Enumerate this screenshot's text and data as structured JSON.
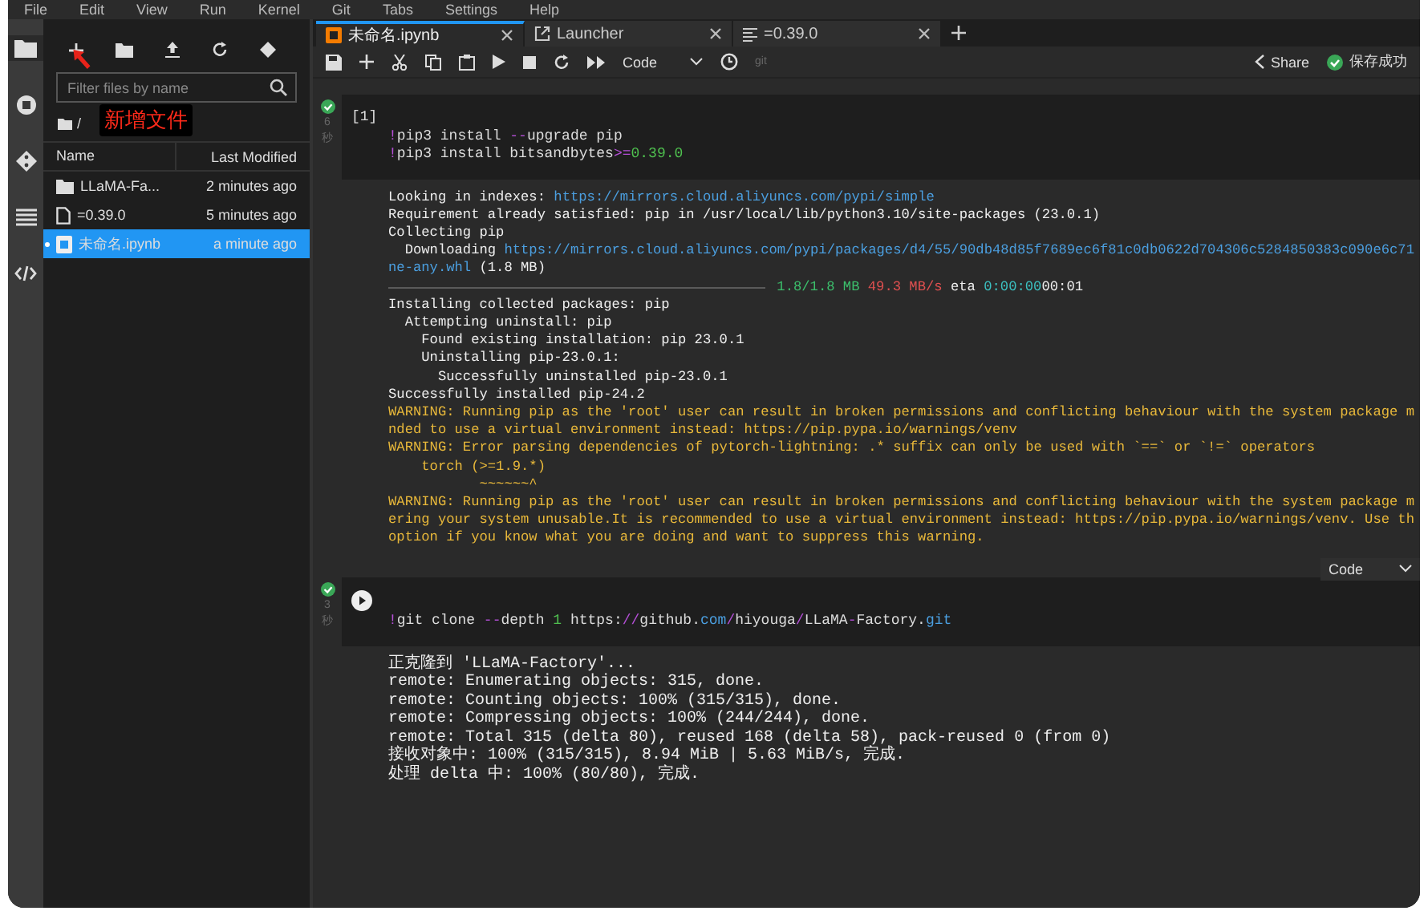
{
  "menu": [
    "File",
    "Edit",
    "View",
    "Run",
    "Kernel",
    "Git",
    "Tabs",
    "Settings",
    "Help"
  ],
  "activity_bar": [
    {
      "kind": "folder",
      "selected": true
    },
    {
      "kind": "running",
      "selected": false
    },
    {
      "kind": "git",
      "selected": false
    },
    {
      "kind": "toc",
      "selected": false
    },
    {
      "kind": "code",
      "selected": false
    }
  ],
  "file_browser": {
    "search": {
      "placeholder": "Filter files by name"
    },
    "path": "/",
    "columns": [
      "Name",
      "Last Modified"
    ],
    "rows": [
      {
        "kind": "folder",
        "name": "LLaMA-Fa...",
        "modified": "2 minutes ago",
        "selected": false,
        "running": false
      },
      {
        "kind": "file",
        "name": "=0.39.0",
        "modified": "5 minutes ago",
        "selected": false,
        "running": false
      },
      {
        "kind": "notebook",
        "name": "未命名.ipynb",
        "modified": "a minute ago",
        "selected": true,
        "running": true
      }
    ]
  },
  "annotation": {
    "label": "新增文件"
  },
  "tabs": [
    {
      "kind": "notebook",
      "label": "未命名.ipynb",
      "selected": true
    },
    {
      "kind": "launcher",
      "label": "Launcher",
      "selected": false
    },
    {
      "kind": "text",
      "label": "=0.39.0",
      "selected": false
    }
  ],
  "toolbar": {
    "cell_type": "Code",
    "git": "git",
    "share": "Share",
    "save_status": "保存成功"
  },
  "cells": [
    {
      "prompt": "[1]",
      "time": "6",
      "unit": "秒",
      "toolbar": false,
      "input": [
        [
          {
            "kind": "op",
            "text": "!"
          },
          {
            "kind": "plain",
            "text": "pip3 install "
          },
          {
            "kind": "op",
            "text": "--"
          },
          {
            "kind": "plain",
            "text": "upgrade pip"
          }
        ],
        [
          {
            "kind": "op",
            "text": "!"
          },
          {
            "kind": "plain",
            "text": "pip3 install bitsandbytes"
          },
          {
            "kind": "op",
            "text": ">="
          },
          {
            "kind": "num",
            "text": "0.39.0"
          }
        ]
      ],
      "output": [
        [
          {
            "kind": "plain",
            "text": "Looking in indexes: "
          },
          {
            "kind": "link",
            "text": "https://mirrors.cloud.aliyuncs.com/pypi/simple"
          }
        ],
        [
          {
            "kind": "plain",
            "text": "Requirement already satisfied: pip in /usr/local/lib/python3.10/site-packages (23.0.1)"
          }
        ],
        [
          {
            "kind": "plain",
            "text": "Collecting pip"
          }
        ],
        [
          {
            "kind": "plain",
            "text": "  Downloading "
          },
          {
            "kind": "link",
            "text": "https://mirrors.cloud.aliyuncs.com/pypi/packages/d4/55/90db48d85f7689ec6f81c0db0622d704306c5284850383c090e6c71"
          }
        ],
        [
          {
            "kind": "link",
            "text": "ne-any.whl"
          },
          {
            "kind": "plain",
            "text": " (1.8 MB)"
          }
        ],
        [
          {
            "kind": "bar",
            "level": 1
          },
          {
            "kind": "ok",
            "text": " 1.8/1.8 MB"
          },
          {
            "kind": "err",
            "text": " 49.3 MB/s"
          },
          {
            "kind": "plain",
            "text": " eta "
          },
          {
            "kind": "cyan",
            "text": "0:00:00"
          },
          {
            "kind": "plain",
            "text": "00:01"
          }
        ],
        [
          {
            "kind": "plain",
            "text": "Installing collected packages: pip"
          }
        ],
        [
          {
            "kind": "plain",
            "text": "  Attempting uninstall: pip"
          }
        ],
        [
          {
            "kind": "plain",
            "text": "    Found existing installation: pip 23.0.1"
          }
        ],
        [
          {
            "kind": "plain",
            "text": "    Uninstalling pip-23.0.1:"
          }
        ],
        [
          {
            "kind": "plain",
            "text": "      Successfully uninstalled pip-23.0.1"
          }
        ],
        [
          {
            "kind": "plain",
            "text": "Successfully installed pip-24.2"
          }
        ],
        [
          {
            "kind": "warn",
            "text": "WARNING: Running pip as the 'root' user can result in broken permissions and conflicting behaviour with the system package m"
          }
        ],
        [
          {
            "kind": "warn",
            "text": "nded to use a virtual environment instead: https://pip.pypa.io/warnings/venv"
          }
        ],
        [
          {
            "kind": "warn",
            "text": "WARNING: Error parsing dependencies of pytorch-lightning: .* suffix can only be used with `==` or `!=` operators"
          }
        ],
        [
          {
            "kind": "warn",
            "text": "    torch (>=1.9.*)"
          }
        ],
        [
          {
            "kind": "warn",
            "text": "           ~~~~~~^"
          }
        ],
        [
          {
            "kind": "warn",
            "text": "WARNING: Running pip as the 'root' user can result in broken permissions and conflicting behaviour with the system package m"
          }
        ],
        [
          {
            "kind": "warn",
            "text": "ering your system unusable.It is recommended to use a virtual environment instead: https://pip.pypa.io/warnings/venv. Use th"
          }
        ],
        [
          {
            "kind": "warn",
            "text": "option if you know what you are doing and want to suppress this warning."
          }
        ]
      ]
    },
    {
      "time": "3",
      "unit": "秒",
      "toolbar": true,
      "cell_type": "Code",
      "input": [
        [
          {
            "kind": "op",
            "text": "!"
          },
          {
            "kind": "plain",
            "text": "git clone "
          },
          {
            "kind": "op",
            "text": "--"
          },
          {
            "kind": "plain",
            "text": "depth "
          },
          {
            "kind": "num",
            "text": "1"
          },
          {
            "kind": "plain",
            "text": " https:"
          },
          {
            "kind": "op",
            "text": "//"
          },
          {
            "kind": "plain",
            "text": "github."
          },
          {
            "kind": "link",
            "text": "com"
          },
          {
            "kind": "op",
            "text": "/"
          },
          {
            "kind": "plain",
            "text": "hiyouga"
          },
          {
            "kind": "op",
            "text": "/"
          },
          {
            "kind": "plain",
            "text": "LLaMA"
          },
          {
            "kind": "op",
            "text": "-"
          },
          {
            "kind": "plain",
            "text": "Factory."
          },
          {
            "kind": "link",
            "text": "git"
          }
        ]
      ],
      "output": [
        [
          {
            "kind": "plain",
            "text": "正克隆到 'LLaMA-Factory'..."
          }
        ],
        [
          {
            "kind": "plain",
            "text": "remote: Enumerating objects: 315, done."
          }
        ],
        [
          {
            "kind": "plain",
            "text": "remote: Counting objects: 100% (315/315), done."
          }
        ],
        [
          {
            "kind": "plain",
            "text": "remote: Compressing objects: 100% (244/244), done."
          }
        ],
        [
          {
            "kind": "plain",
            "text": "remote: Total 315 (delta 80), reused 168 (delta 58), pack-reused 0 (from 0)"
          }
        ],
        [
          {
            "kind": "plain",
            "text": "接收对象中: 100% (315/315), 8.94 MiB | 5.63 MiB/s, 完成."
          }
        ],
        [
          {
            "kind": "plain",
            "text": "处理 delta 中: 100% (80/80), 完成."
          }
        ]
      ]
    }
  ]
}
